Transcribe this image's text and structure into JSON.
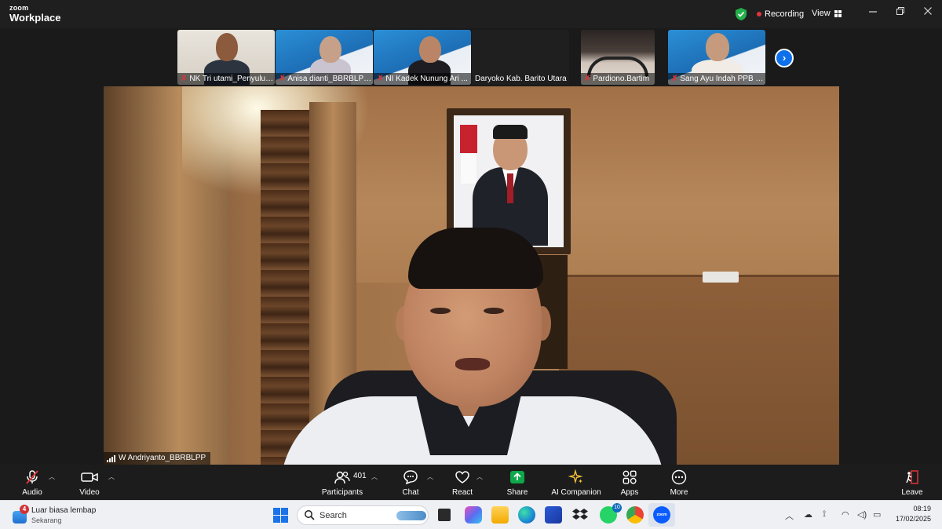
{
  "window": {
    "brand_line1": "zoom",
    "brand_line2": "Workplace",
    "recording_label": "Recording",
    "view_label": "View",
    "controls": [
      "minimize",
      "restore",
      "close"
    ]
  },
  "thumbnails": [
    {
      "name": "NK Tri utami_Penyuluh...",
      "muted": true
    },
    {
      "name": "Anisa dianti_BBRBLPP ...",
      "muted": true
    },
    {
      "name": "NI Kadek Nunung Ari ...",
      "muted": true
    },
    {
      "name": "Daryoko Kab. Barito Utara",
      "muted": false
    },
    {
      "name": "Pardiono.Bartim",
      "muted": true
    },
    {
      "name": "Sang Ayu Indah PPB B...",
      "muted": true
    }
  ],
  "main_video": {
    "speaker_name": "W Andriyanto_BBRBLPP"
  },
  "toolbar": {
    "audio_label": "Audio",
    "video_label": "Video",
    "participants_label": "Participants",
    "participants_count": "401",
    "chat_label": "Chat",
    "react_label": "React",
    "share_label": "Share",
    "ai_label": "AI Companion",
    "apps_label": "Apps",
    "more_label": "More",
    "leave_label": "Leave",
    "share_color": "#0ea84a"
  },
  "taskbar": {
    "weather_badge": "4",
    "weather_title": "Luar biasa lembap",
    "weather_sub": "Sekarang",
    "search_placeholder": "Search",
    "whatsapp_badge": "10",
    "zoom_icon_text": "zoom",
    "time": "08:19",
    "date": "17/02/2025"
  }
}
